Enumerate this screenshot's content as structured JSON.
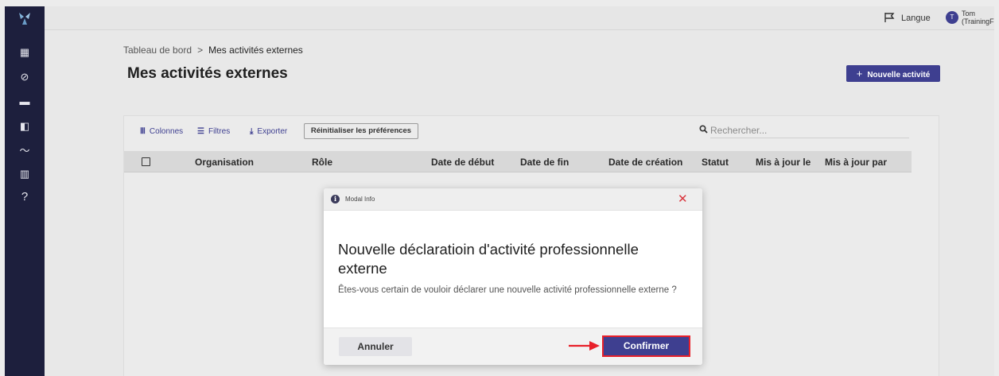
{
  "colors": {
    "sidebar": "#1d1f3d",
    "primary": "#3e3f90",
    "danger": "#d9363e",
    "highlight": "#e8202a"
  },
  "sidebar": {
    "logo": "logo-icon",
    "items": [
      {
        "icon": "dashboard-icon",
        "glyph": "▦"
      },
      {
        "icon": "check-circle-icon",
        "glyph": "⊘"
      },
      {
        "icon": "chat-icon",
        "glyph": "▬"
      },
      {
        "icon": "documents-icon",
        "glyph": "◧"
      },
      {
        "icon": "trend-icon",
        "glyph": "〜"
      },
      {
        "icon": "building-icon",
        "glyph": "▥"
      },
      {
        "icon": "help-icon",
        "glyph": "?"
      }
    ]
  },
  "topbar": {
    "language_label": "Langue",
    "user_initial": "T",
    "user_name": "Tom",
    "user_org": "(TrainingFrench)"
  },
  "breadcrumb": {
    "root": "Tableau de bord",
    "separator": ">",
    "current": "Mes activités externes"
  },
  "page": {
    "title": "Mes activités externes",
    "new_button": "Nouvelle activité"
  },
  "grid": {
    "toolbar": {
      "columns": "Colonnes",
      "filters": "Filtres",
      "export": "Exporter",
      "reset": "Réinitialiser les préférences"
    },
    "search_placeholder": "Rechercher...",
    "columns": [
      "Organisation",
      "Rôle",
      "Date de début",
      "Date de fin",
      "Date de création",
      "Statut",
      "Mis à jour le",
      "Mis à jour par"
    ]
  },
  "modal": {
    "header_title": "Modal Info",
    "title": "Nouvelle déclaratioin d'activité professionnelle externe",
    "text": "Êtes-vous certain de vouloir déclarer une nouvelle activité professionnelle externe ?",
    "cancel": "Annuler",
    "confirm": "Confirmer"
  }
}
